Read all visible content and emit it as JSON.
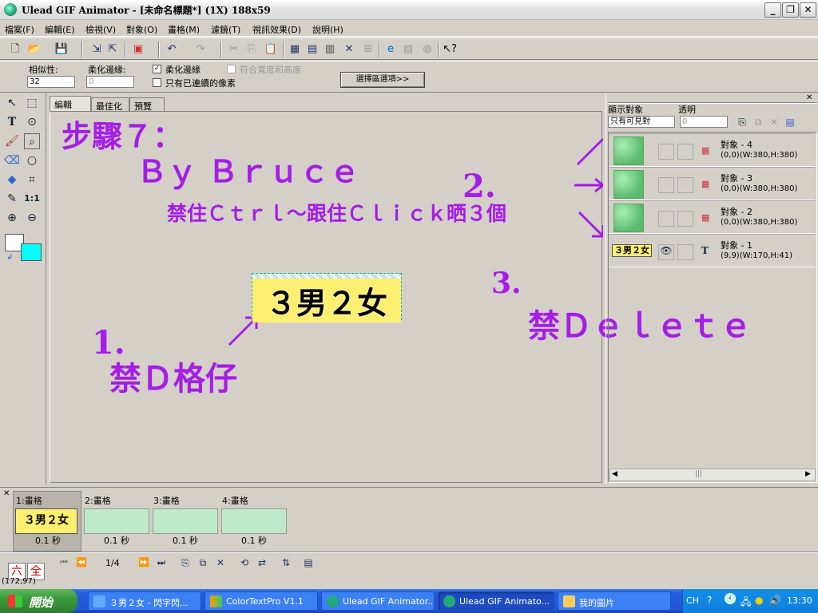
{
  "window": {
    "title": "Ulead GIF Animator - [未命名標題*] (1X) 188x59",
    "buttons": {
      "minimize": "_",
      "restore": "❐",
      "close": "✕"
    }
  },
  "menu": [
    "檔案(F)",
    "編輯(E)",
    "檢視(V)",
    "對象(O)",
    "畫格(M)",
    "濾鏡(T)",
    "視訊效果(D)",
    "說明(H)"
  ],
  "options": {
    "similarity_label": "相似性:",
    "similarity_value": "32",
    "feather_label": "柔化邊緣:",
    "feather_value": "0",
    "antialias_label": "柔化邊緣",
    "fit_label": "符合寬度和高度",
    "contiguous_label": "只有已連續的像素",
    "selection_button": "選擇區選項>>"
  },
  "tabs": [
    "編輯",
    "最佳化",
    "預覽"
  ],
  "canvas": {
    "image_text": "３男２女",
    "annotations": {
      "step_title": "步驟７：",
      "by_line": "Ｂｙ Ｂｒｕｃｅ",
      "instruction": "禁住Ｃｔｒｌ～跟住Ｃｌｉｃｋ晒３個",
      "n1": "1.",
      "n1_text": "禁Ｄ格仔",
      "n2": "2.",
      "n3": "3.",
      "n3_text": "禁Ｄｅｌｅｔｅ"
    }
  },
  "object_panel": {
    "show_label": "顯示對象",
    "transparent_label": "透明",
    "show_select": "只有可見對",
    "transparent_value": "0",
    "objects": [
      {
        "name": "對象 - 4",
        "info": "(0,0)(W:380,H:380)"
      },
      {
        "name": "對象 - 3",
        "info": "(0,0)(W:380,H:380)"
      },
      {
        "name": "對象 - 2",
        "info": "(0,0)(W:380,H:380)"
      },
      {
        "name": "對象 - 1",
        "info": "(9,9)(W:170,H:41)",
        "thumb_text": "３男２女"
      }
    ]
  },
  "frames": {
    "items": [
      {
        "label": "1:畫格",
        "delay": "0.1 秒",
        "thumb_text": "３男２女"
      },
      {
        "label": "2:畫格",
        "delay": "0.1 秒"
      },
      {
        "label": "3:畫格",
        "delay": "0.1 秒"
      },
      {
        "label": "4:畫格",
        "delay": "0.1 秒"
      }
    ],
    "counter": "1/4",
    "ime": [
      "六",
      "全"
    ],
    "status": "(172,97)"
  },
  "taskbar": {
    "start": "開始",
    "tasks": [
      "３男２女 - 閃字閃...",
      "ColorTextPro V1.1",
      "Ulead GIF Animator...",
      "Ulead GIF Animato...",
      "我的圖片"
    ],
    "lang": "CH",
    "clock": "13:30"
  }
}
